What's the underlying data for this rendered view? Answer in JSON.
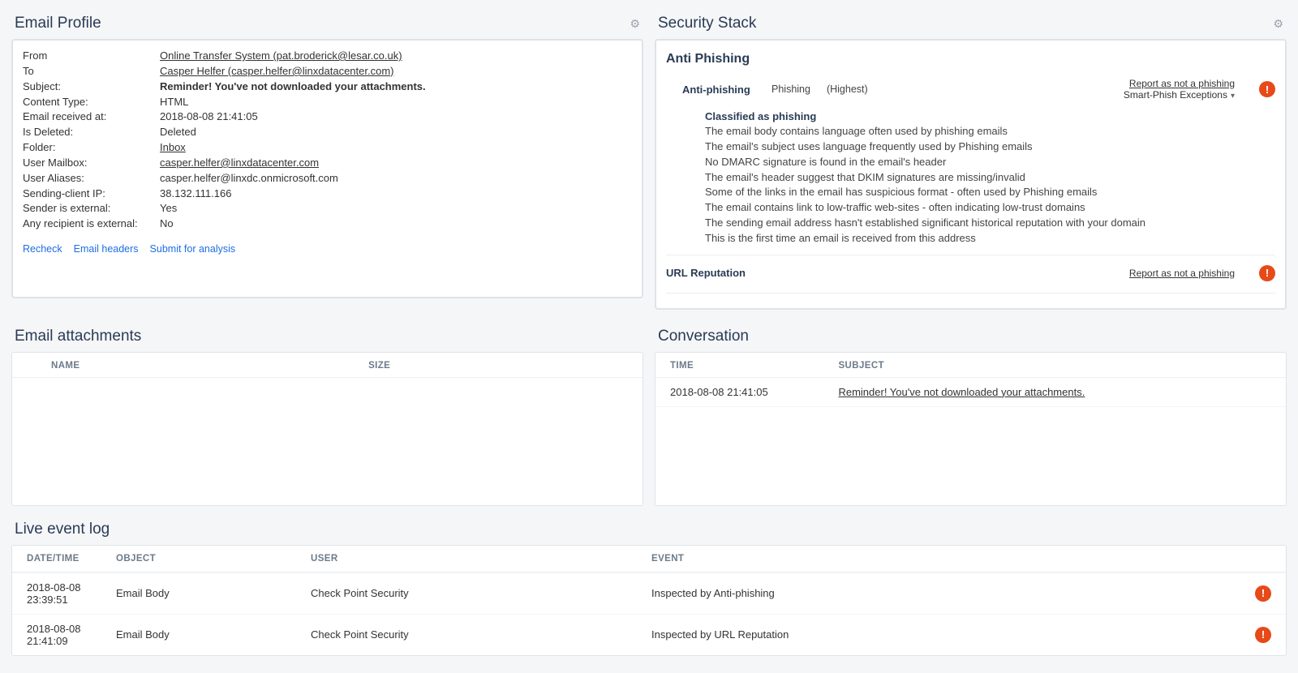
{
  "emailProfile": {
    "title": "Email Profile",
    "fields": {
      "from_label": "From",
      "from_value": "Online Transfer System (pat.broderick@lesar.co.uk)",
      "to_label": "To",
      "to_value": "Casper Helfer (casper.helfer@linxdatacenter.com)",
      "subject_label": "Subject:",
      "subject_value": "Reminder! You've not downloaded your attachments.",
      "contentType_label": "Content Type:",
      "contentType_value": "HTML",
      "receivedAt_label": "Email received at:",
      "receivedAt_value": "2018-08-08 21:41:05",
      "isDeleted_label": "Is Deleted:",
      "isDeleted_value": "Deleted",
      "folder_label": "Folder:",
      "folder_value": "Inbox",
      "mailbox_label": "User Mailbox:",
      "mailbox_value": "casper.helfer@linxdatacenter.com",
      "aliases_label": "User Aliases:",
      "aliases_value": "casper.helfer@linxdc.onmicrosoft.com",
      "clientIp_label": "Sending-client IP:",
      "clientIp_value": "38.132.111.166",
      "senderExternal_label": "Sender is external:",
      "senderExternal_value": "Yes",
      "recipientExternal_label": "Any recipient is external:",
      "recipientExternal_value": "No"
    },
    "actions": {
      "recheck": "Recheck",
      "headers": "Email headers",
      "submit": "Submit for analysis"
    }
  },
  "securityStack": {
    "title": "Security Stack",
    "section_title": "Anti Phishing",
    "antiPhishing": {
      "name": "Anti-phishing",
      "verdict": "Phishing",
      "severity": "(Highest)",
      "reportLink": "Report as not a phishing",
      "exceptions": "Smart-Phish Exceptions"
    },
    "classified": {
      "heading": "Classified as phishing",
      "lines": [
        "The email body contains language often used by phishing emails",
        "The email's subject uses language frequently used by Phishing emails",
        "No DMARC signature is found in the email's header",
        "The email's header suggest that DKIM signatures are missing/invalid",
        "Some of the links in the email has suspicious format - often used by Phishing emails",
        "The email contains link to low-traffic web-sites - often indicating low-trust domains",
        "The sending email address hasn't established significant historical reputation with your domain",
        "This is the first time an email is received from this address"
      ]
    },
    "urlReputation": {
      "name": "URL Reputation",
      "reportLink": "Report as not a phishing"
    }
  },
  "attachments": {
    "title": "Email attachments",
    "columns": {
      "name": "NAME",
      "size": "SIZE"
    }
  },
  "conversation": {
    "title": "Conversation",
    "columns": {
      "time": "TIME",
      "subject": "SUBJECT"
    },
    "rows": [
      {
        "time": "2018-08-08 21:41:05",
        "subject": "Reminder! You've not downloaded your attachments."
      }
    ]
  },
  "eventLog": {
    "title": "Live event log",
    "columns": {
      "datetime": "DATE/TIME",
      "object": "OBJECT",
      "user": "USER",
      "event": "EVENT"
    },
    "rows": [
      {
        "datetime": "2018-08-08 23:39:51",
        "object": "Email Body",
        "user": "Check Point Security",
        "event": "Inspected by Anti-phishing"
      },
      {
        "datetime": "2018-08-08 21:41:09",
        "object": "Email Body",
        "user": "Check Point Security",
        "event": "Inspected by URL Reputation"
      }
    ]
  }
}
